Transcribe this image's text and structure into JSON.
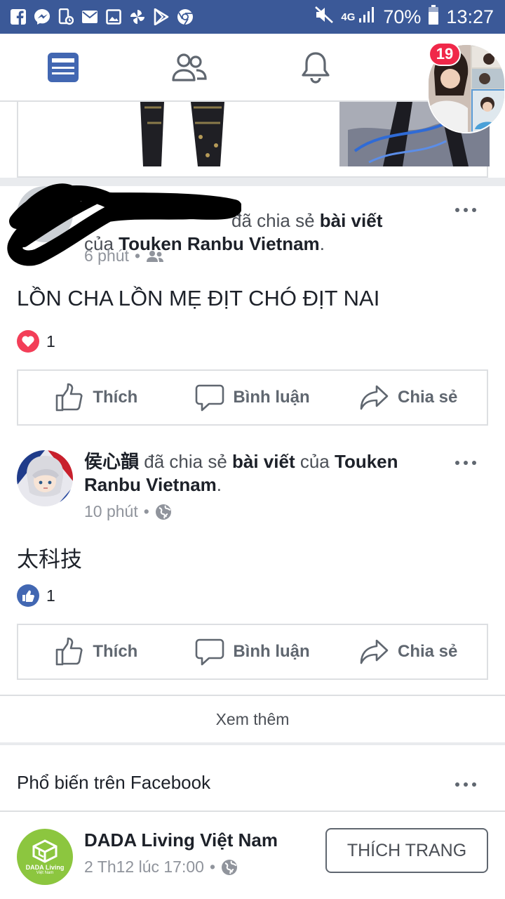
{
  "status_bar": {
    "battery": "70%",
    "time": "13:27",
    "network": "4G"
  },
  "nav": {
    "notifications_badge": "19"
  },
  "posts": [
    {
      "author": "",
      "action": "đã chia sẻ",
      "object": "bài viết",
      "of": "của",
      "page": "Touken Ranbu Vietnam",
      "time": "6 phút",
      "privacy_icon": "friends-icon",
      "text": "LỒN CHA LỒN MẸ ĐỊT CHÓ ĐỊT NAI",
      "reaction_type": "love",
      "reaction_count": "1"
    },
    {
      "author": "侯心韻",
      "action": "đã chia sẻ",
      "object": "bài viết",
      "of": "của",
      "page": "Touken Ranbu Vietnam",
      "time": "10 phút",
      "privacy_icon": "globe-icon",
      "text": "太科技",
      "reaction_type": "like",
      "reaction_count": "1"
    }
  ],
  "actions": {
    "like": "Thích",
    "comment": "Bình luận",
    "share": "Chia sẻ"
  },
  "see_more": "Xem thêm",
  "popular": {
    "title": "Phổ biến trên Facebook",
    "page_name": "DADA Living Việt Nam",
    "page_time": "2 Th12 lúc 17:00",
    "logo_text": "DADA Living",
    "logo_subtext": "Việt Nam",
    "like_page_button": "THÍCH TRANG"
  },
  "colors": {
    "brand": "#3b5998",
    "accent": "#4267b2",
    "love": "#f33e58",
    "badge": "#f02849",
    "dada_green": "#8cc63f"
  }
}
